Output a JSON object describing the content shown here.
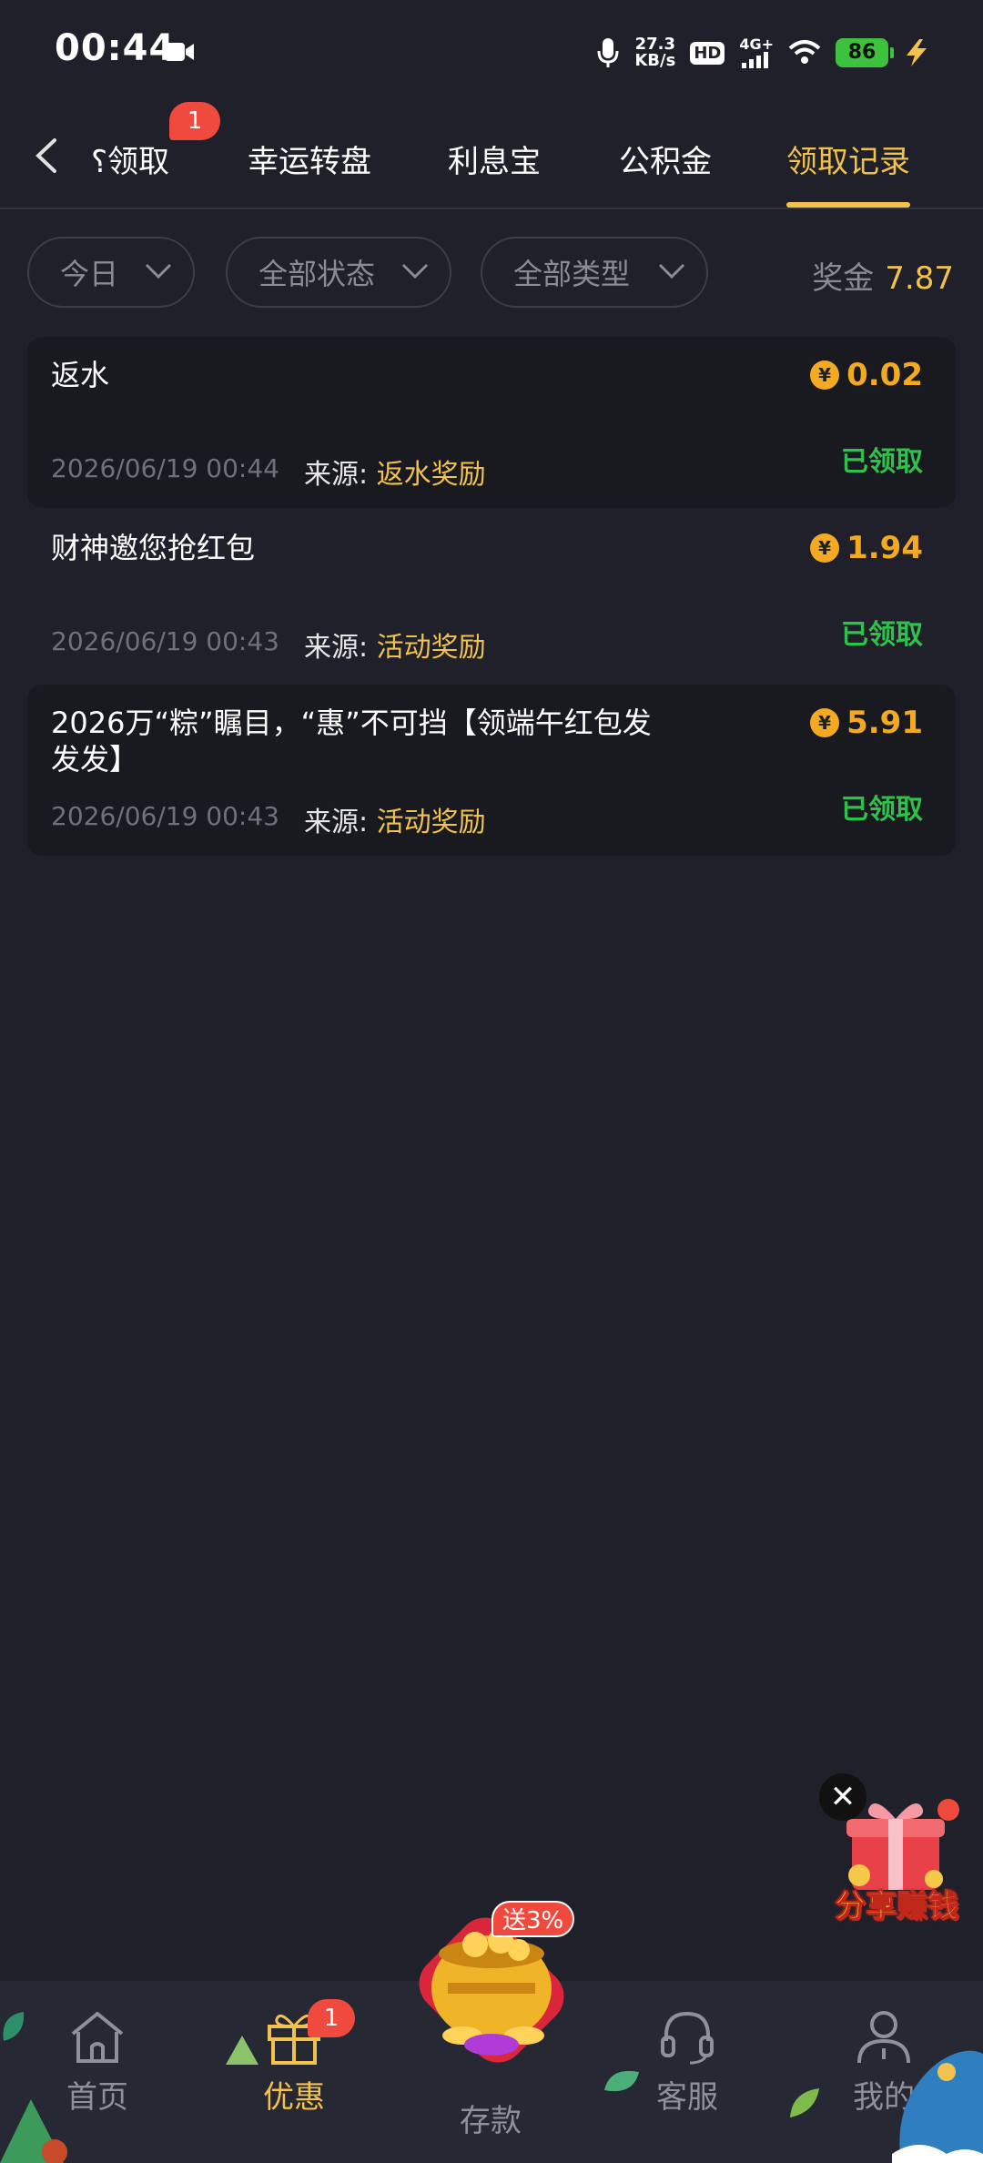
{
  "status_bar": {
    "time": "00:44",
    "speed_value": "27.3",
    "speed_unit": "KB/s",
    "hd": "HD",
    "network": "4G+",
    "battery": "86"
  },
  "tabs": [
    {
      "label": "待领取",
      "visible": "⸮领取",
      "badge": "1"
    },
    {
      "label": "幸运转盘"
    },
    {
      "label": "利息宝"
    },
    {
      "label": "公积金"
    },
    {
      "label": "领取记录",
      "active": true
    }
  ],
  "filters": {
    "date": "今日",
    "status": "全部状态",
    "type": "全部类型",
    "bonus_label": "奖金",
    "bonus_amount": "7.87"
  },
  "records": [
    {
      "title": "返水",
      "amount": "0.02",
      "date": "2026/06/19 00:44",
      "source_label": "来源:",
      "source": "返水奖励",
      "status": "已领取"
    },
    {
      "title": "财神邀您抢红包",
      "amount": "1.94",
      "date": "2026/06/19 00:43",
      "source_label": "来源:",
      "source": "活动奖励",
      "status": "已领取"
    },
    {
      "title": "2026万“粽”瞩目，“惠”不可挡【领端午红包发发发】",
      "amount": "5.91",
      "date": "2026/06/19 00:43",
      "source_label": "来源:",
      "source": "活动奖励",
      "status": "已领取"
    }
  ],
  "currency_symbol": "¥",
  "promo": {
    "close": "✕",
    "label": "分享赚钱"
  },
  "nav": {
    "home": "首页",
    "promo": "优惠",
    "promo_badge": "1",
    "deposit": "存款",
    "deposit_badge": "送3%",
    "service": "客服",
    "mine": "我的"
  },
  "colors": {
    "background": "#1f2029",
    "accent": "#f2c14e",
    "amount": "#f4a922",
    "success": "#2fc24a",
    "badge": "#f04a3e"
  }
}
